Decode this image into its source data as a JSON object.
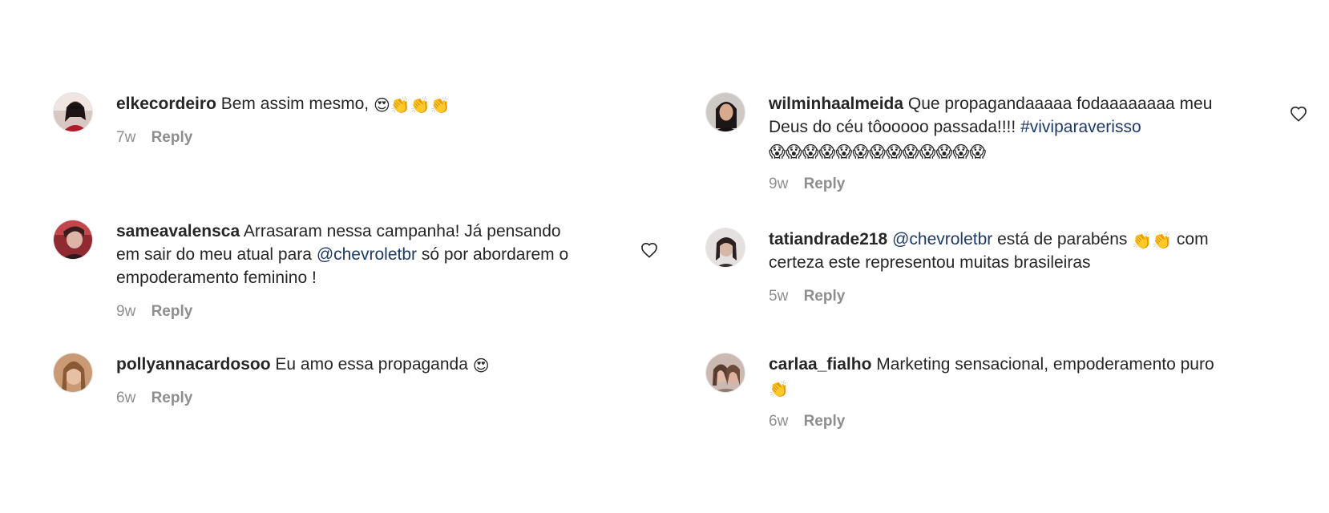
{
  "colors": {
    "text": "#262626",
    "muted": "#8e8e8e",
    "link": "#1e3a68"
  },
  "comments": [
    {
      "username": "elkecordeiro",
      "text": "Bem assim mesmo,",
      "emojis": "😍👏👏👏",
      "time": "7w",
      "reply": "Reply"
    },
    {
      "username": "sameavalensca",
      "line1": "Arrasaram nessa campanha! Já pensando",
      "line2_pre": "em sair do meu atual para",
      "mention": "@chevroletbr",
      "line2_post": "só por abordarem o",
      "line3": "empoderamento feminino !",
      "time": "9w",
      "reply": "Reply"
    },
    {
      "username": "pollyannacardosoo",
      "text": "Eu amo essa propaganda",
      "emojis": "😍",
      "time": "6w",
      "reply": "Reply"
    },
    {
      "username": "wilminhaalmeida",
      "line1": "Que propagandaaaaa fodaaaaaaaa meu",
      "line2_pre": "Deus do céu tôooooo passada!!!!",
      "hashtag": "#viviparaverisso",
      "emojis": "😱😱😱😱😱😱😱😱😱😱😱😱😱",
      "time": "9w",
      "reply": "Reply"
    },
    {
      "username": "tatiandrade218",
      "mention": "@chevroletbr",
      "line1_post": "está de parabéns",
      "emojis": "👏👏",
      "line1_end": "com",
      "line2": "certeza este representou muitas brasileiras",
      "time": "5w",
      "reply": "Reply"
    },
    {
      "username": "carlaa_fialho",
      "line1": "Marketing sensacional, empoderamento puro",
      "emojis": "👏",
      "time": "6w",
      "reply": "Reply"
    }
  ],
  "icons": {
    "avatar": "avatar",
    "like": "heart-outline-icon"
  }
}
